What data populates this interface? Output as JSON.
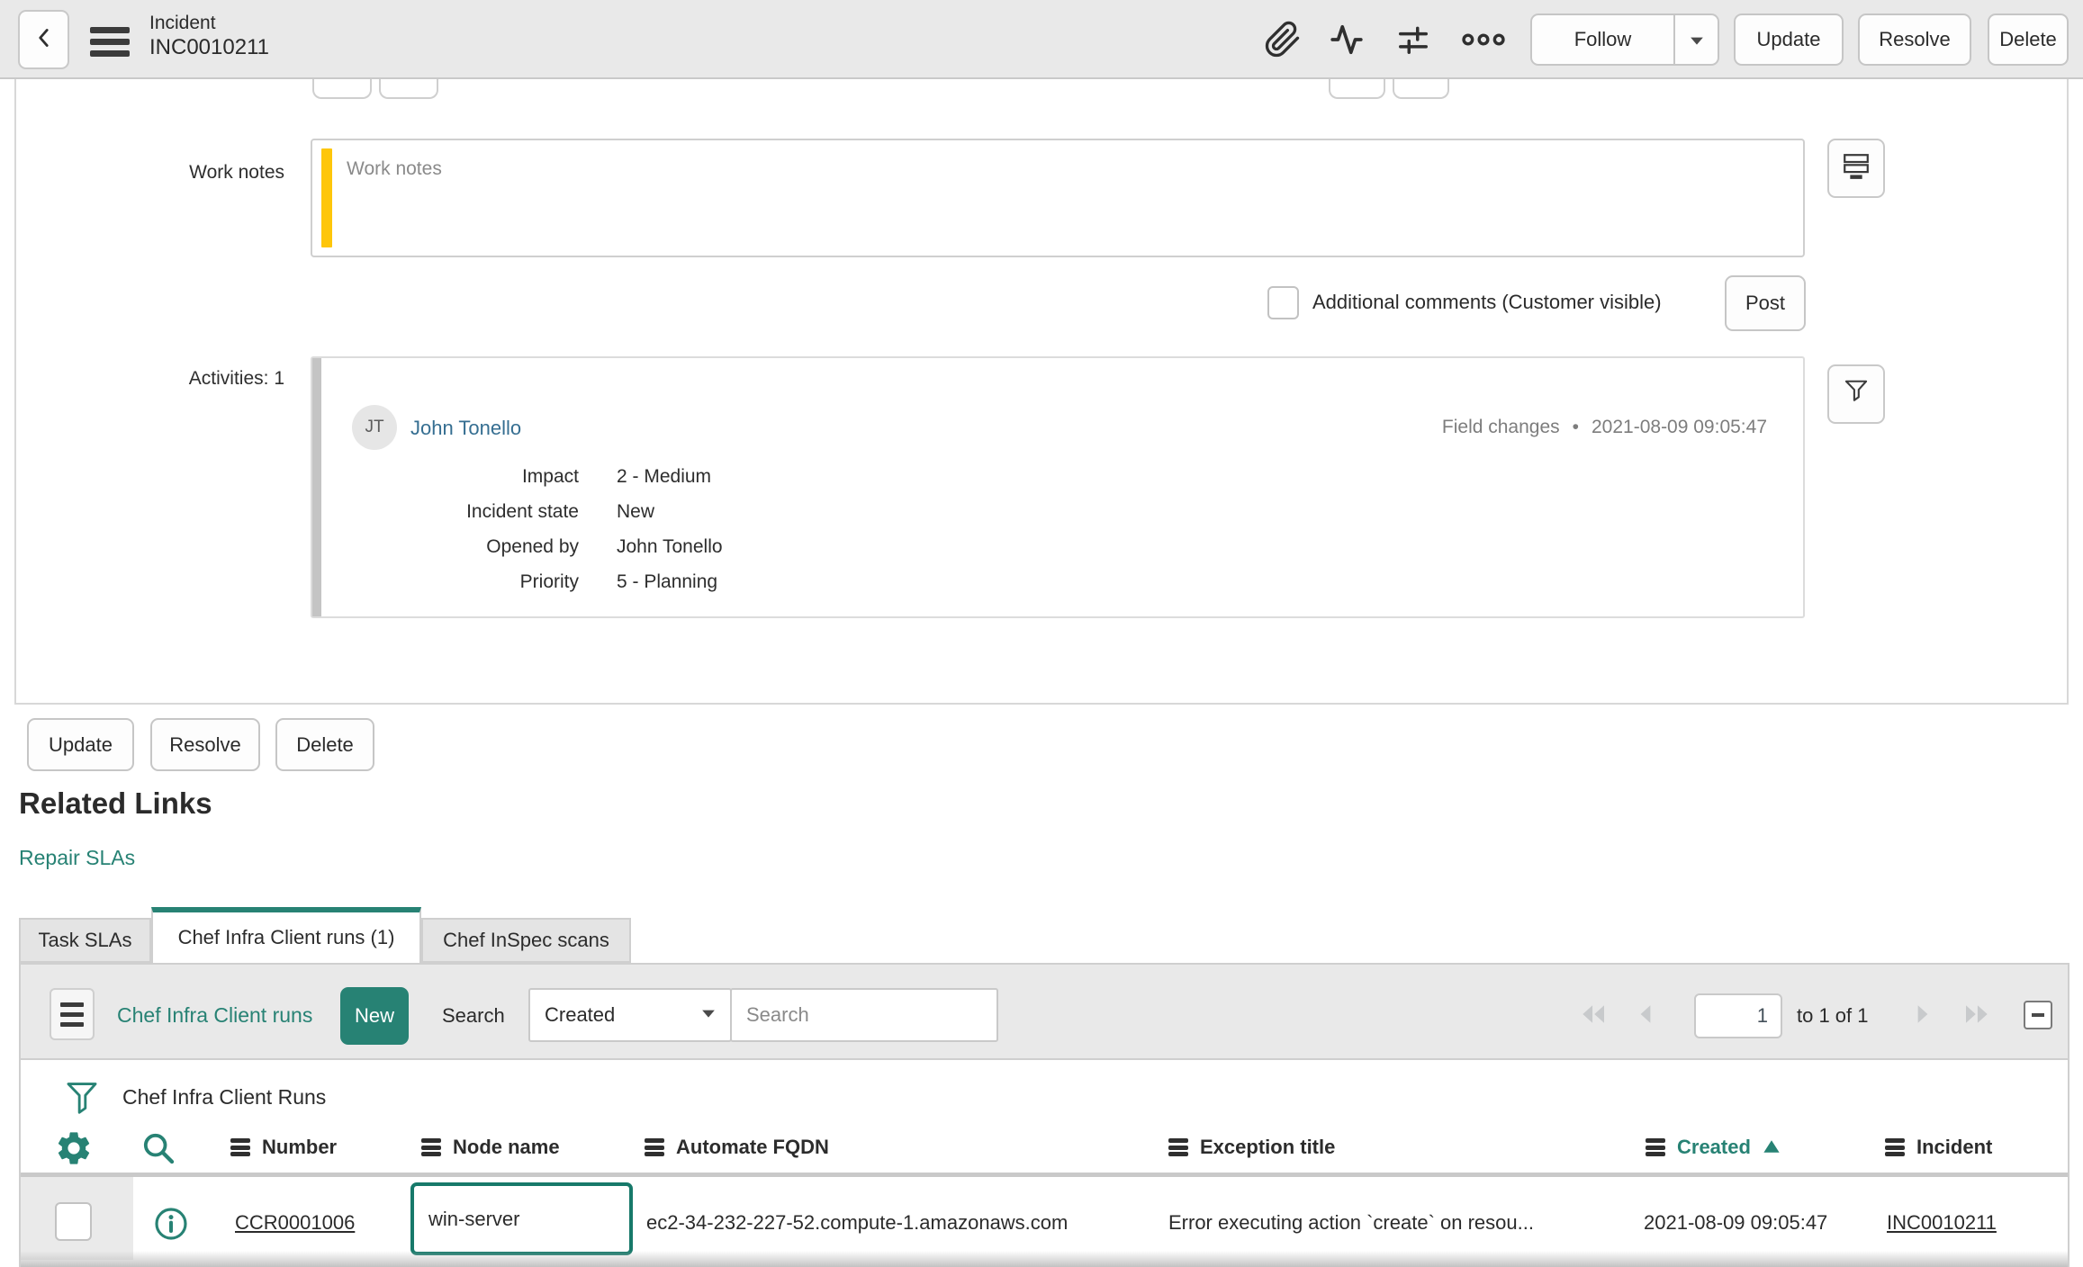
{
  "header": {
    "title_line1": "Incident",
    "title_line2": "INC0010211",
    "follow_label": "Follow",
    "update_label": "Update",
    "resolve_label": "Resolve",
    "delete_label": "Delete"
  },
  "form": {
    "work_notes": {
      "label": "Work notes",
      "placeholder": "Work notes",
      "value": ""
    },
    "additional_comments_label": "Additional comments (Customer visible)",
    "post_label": "Post",
    "activities": {
      "label": "Activities: 1",
      "entry": {
        "avatar_initials": "JT",
        "user": "John Tonello",
        "type": "Field changes",
        "separator": "•",
        "timestamp": "2021-08-09 09:05:47",
        "fields": [
          {
            "label": "Impact",
            "value": "2 - Medium"
          },
          {
            "label": "Incident state",
            "value": "New"
          },
          {
            "label": "Opened by",
            "value": "John Tonello"
          },
          {
            "label": "Priority",
            "value": "5 - Planning"
          }
        ]
      }
    },
    "buttons": {
      "update": "Update",
      "resolve": "Resolve",
      "delete": "Delete"
    }
  },
  "related_links": {
    "title": "Related Links",
    "links": [
      "Repair SLAs"
    ]
  },
  "tabs": [
    {
      "label": "Task SLAs",
      "active": false
    },
    {
      "label": "Chef Infra Client runs (1)",
      "active": true
    },
    {
      "label": "Chef InSpec scans",
      "active": false
    }
  ],
  "list": {
    "toolbar": {
      "title_link": "Chef Infra Client runs",
      "new_label": "New",
      "search_label": "Search",
      "search_field_selected": "Created",
      "search_placeholder": "Search",
      "page_value": "1",
      "range_text": "to 1 of 1"
    },
    "filter_title": "Chef Infra Client Runs",
    "columns": [
      "Number",
      "Node name",
      "Automate FQDN",
      "Exception title",
      "Created",
      "Incident"
    ],
    "sorted_column": "Created",
    "sort_direction": "asc",
    "rows": [
      {
        "number": "CCR0001006",
        "node_name": "win-server",
        "automate_fqdn": "ec2-34-232-227-52.compute-1.amazonaws.com",
        "exception_title": "Error executing action `create` on resou...",
        "created": "2021-08-09 09:05:47",
        "incident": "INC0010211"
      }
    ]
  },
  "colors": {
    "accent_teal": "#278274",
    "work_notes_accent": "#fec60a",
    "header_bg": "#e9e9e9",
    "activity_user": "#356e91"
  }
}
